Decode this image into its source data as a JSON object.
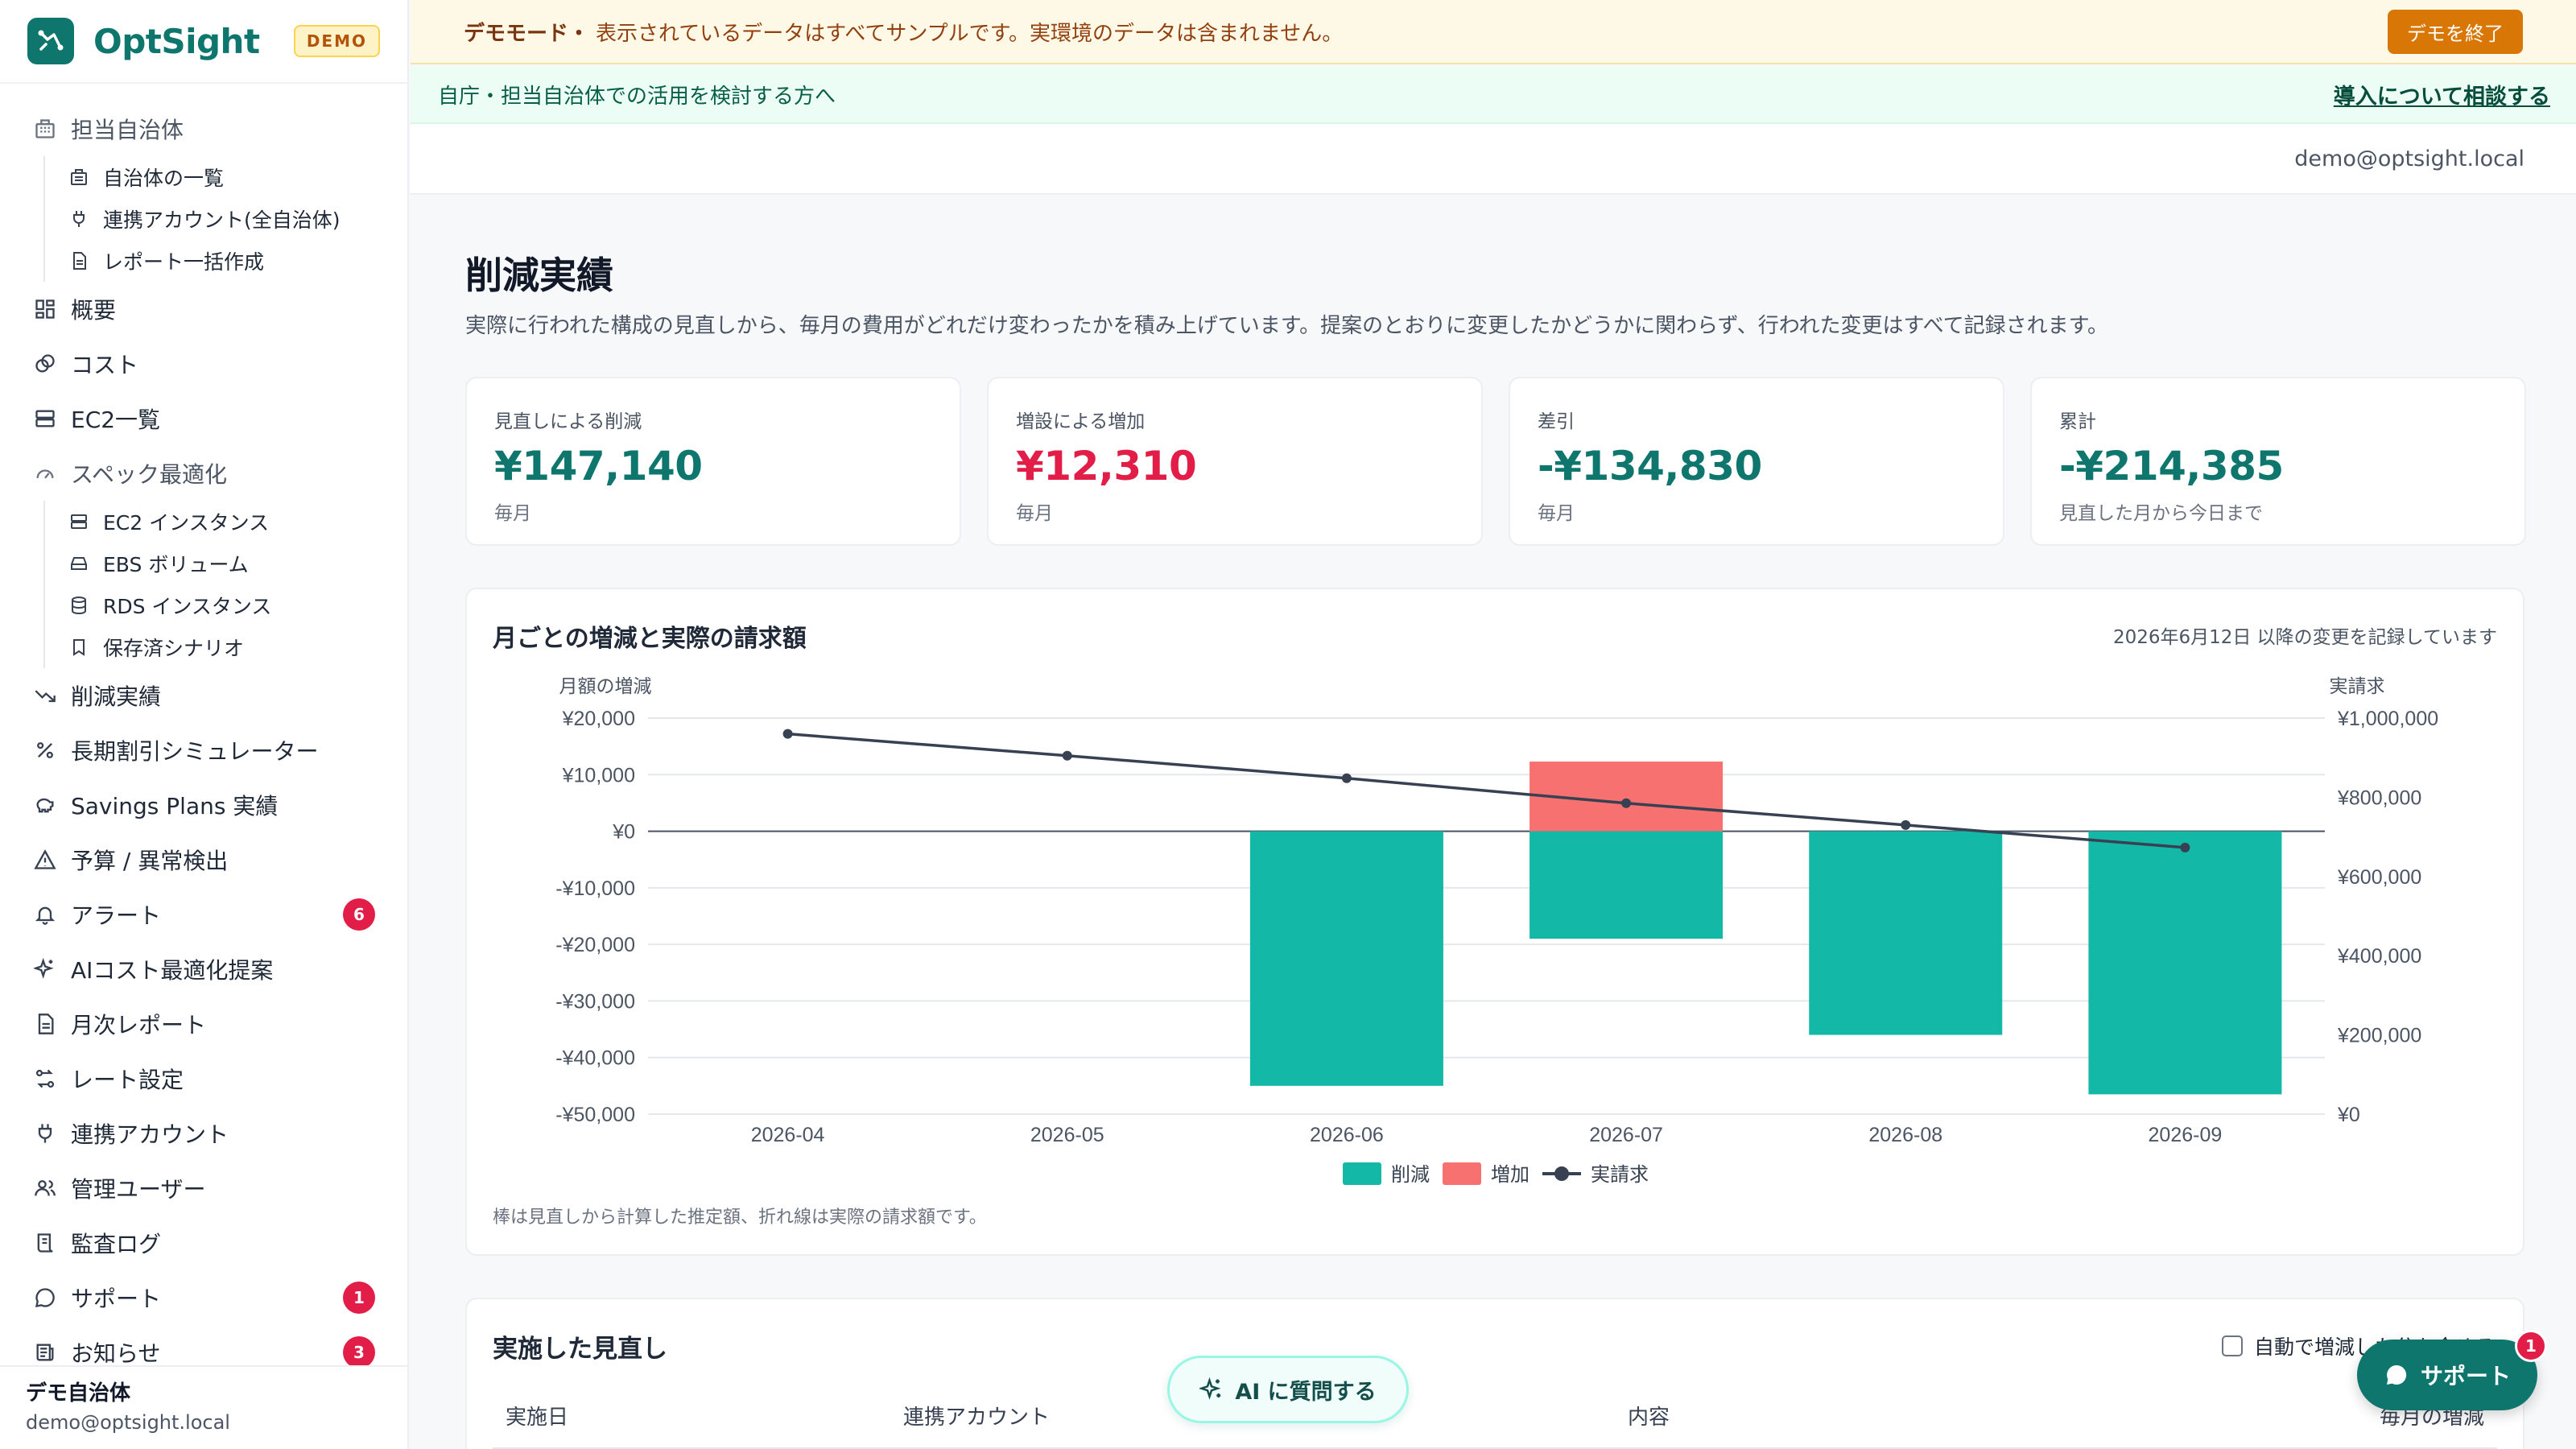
{
  "brand": {
    "name": "OptSight",
    "badge": "DEMO"
  },
  "sidebar": {
    "group_tenant": {
      "label": "担当自治体",
      "items": [
        {
          "label": "自治体の一覧",
          "icon": "building-icon"
        },
        {
          "label": "連携アカウント(全自治体)",
          "icon": "plug-icon"
        },
        {
          "label": "レポート一括作成",
          "icon": "document-icon"
        }
      ]
    },
    "items": [
      {
        "label": "概要",
        "icon": "grid-icon"
      },
      {
        "label": "コスト",
        "icon": "coins-icon"
      },
      {
        "label": "EC2一覧",
        "icon": "server-icon"
      }
    ],
    "group_spec": {
      "label": "スペック最適化",
      "items": [
        {
          "label": "EC2 インスタンス",
          "icon": "server-icon"
        },
        {
          "label": "EBS ボリューム",
          "icon": "drive-icon"
        },
        {
          "label": "RDS インスタンス",
          "icon": "database-icon"
        },
        {
          "label": "保存済シナリオ",
          "icon": "bookmark-icon"
        }
      ]
    },
    "items2": [
      {
        "label": "削減実績",
        "icon": "trending-down-icon"
      },
      {
        "label": "長期割引シミュレーター",
        "icon": "percent-icon"
      },
      {
        "label": "Savings Plans 実績",
        "icon": "piggy-bank-icon"
      },
      {
        "label": "予算 / 異常検出",
        "icon": "warning-icon"
      },
      {
        "label": "アラート",
        "icon": "bell-icon",
        "badge": "6"
      },
      {
        "label": "AIコスト最適化提案",
        "icon": "sparkles-icon"
      },
      {
        "label": "月次レポート",
        "icon": "document-icon"
      },
      {
        "label": "レート設定",
        "icon": "exchange-icon"
      },
      {
        "label": "連携アカウント",
        "icon": "plug-icon"
      },
      {
        "label": "管理ユーザー",
        "icon": "users-icon"
      },
      {
        "label": "監査ログ",
        "icon": "scroll-icon"
      },
      {
        "label": "サポート",
        "icon": "chat-icon",
        "badge": "1"
      },
      {
        "label": "お知らせ",
        "icon": "newspaper-icon",
        "badge": "3"
      }
    ],
    "footer": {
      "name": "デモ自治体",
      "email": "demo@optsight.local"
    }
  },
  "demo_banner": {
    "title": "デモモード・",
    "text": "表示されているデータはすべてサンプルです。実環境のデータは含まれません。",
    "exit_label": "デモを終了"
  },
  "consult_banner": {
    "text": "自庁・担当自治体での活用を検討する方へ",
    "link": "導入について相談する"
  },
  "user": {
    "email": "demo@optsight.local"
  },
  "page": {
    "title": "削減実績",
    "description": "実際に行われた構成の見直しから、毎月の費用がどれだけ変わったかを積み上げています。提案のとおりに変更したかどうかに関わらず、行われた変更はすべて記録されます。"
  },
  "kpis": [
    {
      "label": "見直しによる削減",
      "value": "¥147,140",
      "sub": "毎月",
      "color": "#0f766e"
    },
    {
      "label": "増設による増加",
      "value": "¥12,310",
      "sub": "毎月",
      "color": "#e11d48"
    },
    {
      "label": "差引",
      "value": "-¥134,830",
      "sub": "毎月",
      "color": "#0f766e"
    },
    {
      "label": "累計",
      "value": "-¥214,385",
      "sub": "見直した月から今日まで",
      "color": "#0f766e"
    }
  ],
  "chart": {
    "title": "月ごとの増減と実際の請求額",
    "note": "2026年6月12日 以降の変更を記録しています",
    "footnote": "棒は見直しから計算した推定額、折れ線は実際の請求額です。"
  },
  "chart_data": {
    "type": "bar",
    "categories": [
      "2026-04",
      "2026-05",
      "2026-06",
      "2026-07",
      "2026-08",
      "2026-09"
    ],
    "left_axis_label": "月額の増減",
    "right_axis_label": "実請求",
    "left_ticks": [
      "¥20,000",
      "¥10,000",
      "¥0",
      "-¥10,000",
      "-¥20,000",
      "-¥30,000",
      "-¥40,000",
      "-¥50,000"
    ],
    "right_ticks": [
      "¥1,000,000",
      "¥800,000",
      "¥600,000",
      "¥400,000",
      "¥200,000",
      "¥0"
    ],
    "ylim_left": [
      -50000,
      20000
    ],
    "ylim_right": [
      0,
      1000000
    ],
    "series": [
      {
        "name": "削減",
        "type": "bar",
        "axis": "left",
        "color": "#14b8a6",
        "values": [
          0,
          0,
          -45000,
          -19000,
          -36000,
          -46500
        ]
      },
      {
        "name": "増加",
        "type": "bar",
        "axis": "left",
        "color": "#f87171",
        "values": [
          0,
          0,
          0,
          12310,
          0,
          0
        ]
      },
      {
        "name": "実請求",
        "type": "line",
        "axis": "right",
        "color": "#374151",
        "values": [
          960000,
          905000,
          848000,
          785000,
          730000,
          673000
        ]
      }
    ],
    "legend_position": "bottom",
    "grid": true
  },
  "table": {
    "title": "実施した見直し",
    "checkbox_label": "自動で増減した分も含める",
    "columns": [
      "実施日",
      "連携アカウント",
      "内容",
      "毎月の増減"
    ]
  },
  "ai_button": {
    "label": "AI に質問する"
  },
  "support_button": {
    "label": "サポート",
    "badge": "1"
  }
}
